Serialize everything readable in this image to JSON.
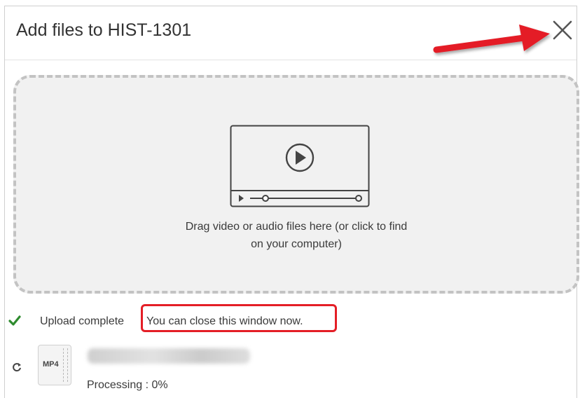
{
  "dialog": {
    "title": "Add files to HIST-1301",
    "close_label": "✕"
  },
  "dropzone": {
    "text_line1": "Drag video or audio files here (or click to find",
    "text_line2": "on your computer)"
  },
  "status": {
    "upload_complete": "Upload complete",
    "close_message": "You can close this window now."
  },
  "file": {
    "type_label": "MP4",
    "name": "",
    "processing": "Processing : 0%"
  },
  "colors": {
    "annotation_red": "#e41e26",
    "check_green": "#2e8b2e"
  },
  "icons": {
    "close": "close-icon",
    "video": "video-player-icon",
    "check": "checkmark-icon",
    "refresh": "refresh-icon",
    "file": "mp4-file-icon"
  }
}
